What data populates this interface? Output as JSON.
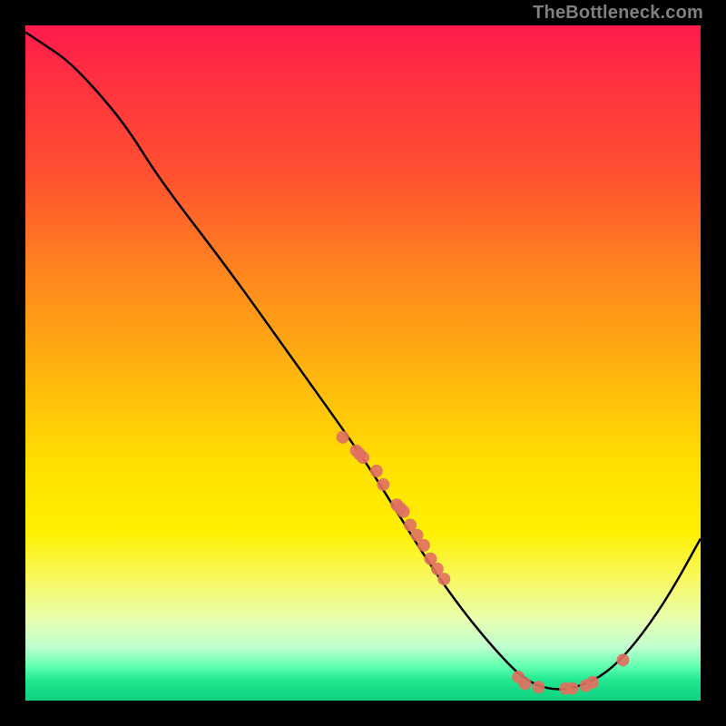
{
  "attribution": "TheBottleneck.com",
  "chart_data": {
    "type": "line",
    "title": "",
    "xlabel": "",
    "ylabel": "",
    "xlim": [
      0,
      100
    ],
    "ylim": [
      0,
      100
    ],
    "grid": false,
    "curve_points": [
      {
        "x": 0,
        "y": 99
      },
      {
        "x": 3,
        "y": 97
      },
      {
        "x": 6,
        "y": 95
      },
      {
        "x": 10,
        "y": 91
      },
      {
        "x": 15,
        "y": 85
      },
      {
        "x": 20,
        "y": 77
      },
      {
        "x": 30,
        "y": 64
      },
      {
        "x": 40,
        "y": 50
      },
      {
        "x": 50,
        "y": 36
      },
      {
        "x": 55,
        "y": 28
      },
      {
        "x": 60,
        "y": 20
      },
      {
        "x": 65,
        "y": 13
      },
      {
        "x": 70,
        "y": 7
      },
      {
        "x": 74,
        "y": 3
      },
      {
        "x": 78,
        "y": 1.5
      },
      {
        "x": 82,
        "y": 2
      },
      {
        "x": 86,
        "y": 4
      },
      {
        "x": 90,
        "y": 8
      },
      {
        "x": 95,
        "y": 15
      },
      {
        "x": 100,
        "y": 24
      }
    ],
    "markers_cluster_upper": [
      {
        "x": 47,
        "y": 39
      },
      {
        "x": 49,
        "y": 37
      },
      {
        "x": 49.5,
        "y": 36.5
      },
      {
        "x": 50,
        "y": 36
      },
      {
        "x": 52,
        "y": 34
      },
      {
        "x": 53,
        "y": 32
      },
      {
        "x": 55,
        "y": 29
      },
      {
        "x": 55.5,
        "y": 28.5
      },
      {
        "x": 56,
        "y": 28
      },
      {
        "x": 57,
        "y": 26
      },
      {
        "x": 58,
        "y": 24.5
      },
      {
        "x": 59,
        "y": 23
      },
      {
        "x": 60,
        "y": 21
      },
      {
        "x": 61,
        "y": 19.5
      },
      {
        "x": 62,
        "y": 18
      }
    ],
    "markers_cluster_lower": [
      {
        "x": 73,
        "y": 3.5
      },
      {
        "x": 74,
        "y": 2.5
      },
      {
        "x": 76,
        "y": 2
      },
      {
        "x": 80,
        "y": 1.8
      },
      {
        "x": 81,
        "y": 1.8
      },
      {
        "x": 83,
        "y": 2.2
      },
      {
        "x": 84,
        "y": 2.7
      },
      {
        "x": 88.5,
        "y": 6
      }
    ],
    "marker_color": "#e07060",
    "marker_radius": 7
  }
}
